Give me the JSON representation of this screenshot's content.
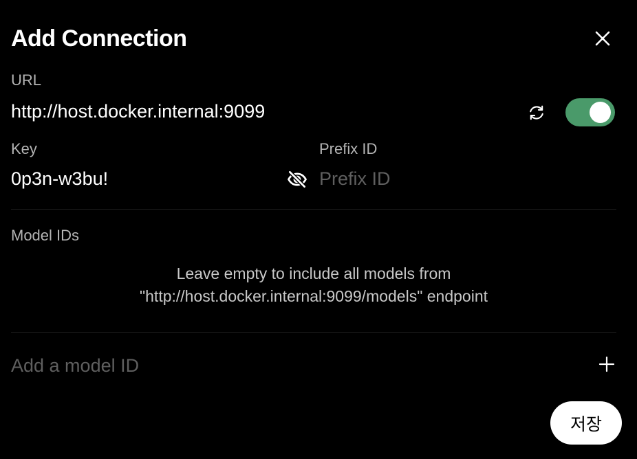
{
  "dialog": {
    "title": "Add Connection"
  },
  "url": {
    "label": "URL",
    "value": "http://host.docker.internal:9099",
    "enabled": true
  },
  "key": {
    "label": "Key",
    "value": "0p3n-w3bu!"
  },
  "prefix": {
    "label": "Prefix ID",
    "value": "",
    "placeholder": "Prefix ID"
  },
  "models": {
    "label": "Model IDs",
    "hint_line1": "Leave empty to include all models from",
    "hint_line2": "\"http://host.docker.internal:9099/models\" endpoint",
    "add_value": "",
    "add_placeholder": "Add a model ID"
  },
  "actions": {
    "save_label": "저장"
  },
  "colors": {
    "background": "#000000",
    "toggle_on": "#4a9a6a",
    "label": "#b4b4b4",
    "placeholder": "#5f5f5f"
  },
  "icons": {
    "close": "close-icon",
    "refresh": "refresh-icon",
    "eye_off": "eye-off-icon",
    "plus": "plus-icon"
  }
}
